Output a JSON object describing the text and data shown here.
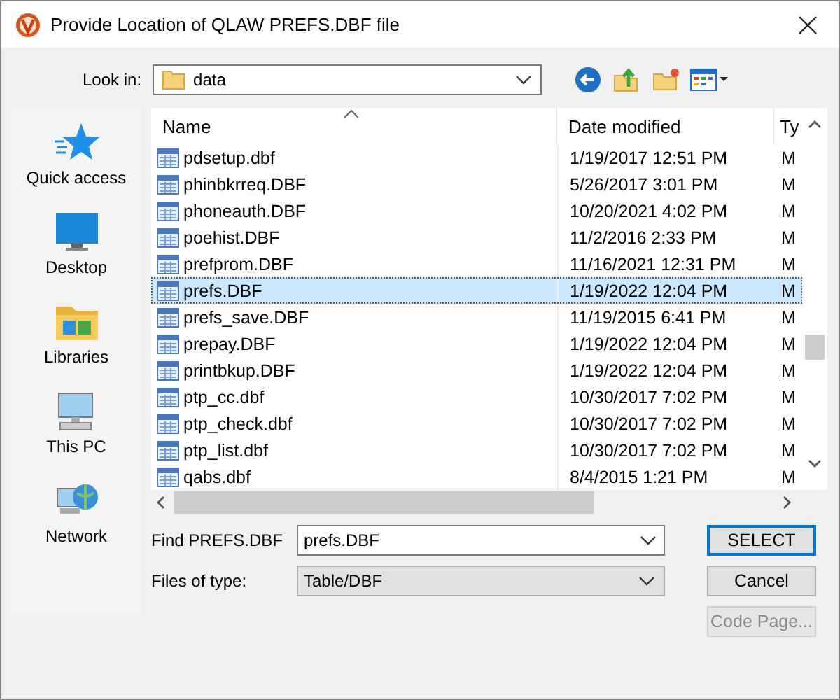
{
  "window": {
    "title": "Provide Location of QLAW PREFS.DBF file"
  },
  "look_in": {
    "label": "Look in:",
    "value": "data"
  },
  "sidebar": {
    "items": [
      {
        "label": "Quick access",
        "kind": "star"
      },
      {
        "label": "Desktop",
        "kind": "desktop"
      },
      {
        "label": "Libraries",
        "kind": "libraries"
      },
      {
        "label": "This PC",
        "kind": "pc"
      },
      {
        "label": "Network",
        "kind": "network"
      }
    ]
  },
  "table": {
    "columns": [
      "Name",
      "Date modified",
      "Ty"
    ],
    "rows": [
      {
        "name": "pdsetup.dbf",
        "date": "1/19/2017 12:51 PM",
        "type": "M",
        "selected": false
      },
      {
        "name": "phinbkrreq.DBF",
        "date": "5/26/2017 3:01 PM",
        "type": "M",
        "selected": false
      },
      {
        "name": "phoneauth.DBF",
        "date": "10/20/2021 4:02 PM",
        "type": "M",
        "selected": false
      },
      {
        "name": "poehist.DBF",
        "date": "11/2/2016 2:33 PM",
        "type": "M",
        "selected": false
      },
      {
        "name": "prefprom.DBF",
        "date": "11/16/2021 12:31 PM",
        "type": "M",
        "selected": false
      },
      {
        "name": "prefs.DBF",
        "date": "1/19/2022 12:04 PM",
        "type": "M",
        "selected": true
      },
      {
        "name": "prefs_save.DBF",
        "date": "11/19/2015 6:41 PM",
        "type": "M",
        "selected": false
      },
      {
        "name": "prepay.DBF",
        "date": "1/19/2022 12:04 PM",
        "type": "M",
        "selected": false
      },
      {
        "name": "printbkup.DBF",
        "date": "1/19/2022 12:04 PM",
        "type": "M",
        "selected": false
      },
      {
        "name": "ptp_cc.dbf",
        "date": "10/30/2017 7:02 PM",
        "type": "M",
        "selected": false
      },
      {
        "name": "ptp_check.dbf",
        "date": "10/30/2017 7:02 PM",
        "type": "M",
        "selected": false
      },
      {
        "name": "ptp_list.dbf",
        "date": "10/30/2017 7:02 PM",
        "type": "M",
        "selected": false
      },
      {
        "name": "qabs.dbf",
        "date": "8/4/2015 1:21 PM",
        "type": "M",
        "selected": false
      }
    ]
  },
  "find": {
    "label": "Find PREFS.DBF",
    "value": "prefs.DBF"
  },
  "file_type": {
    "label": "Files of type:",
    "value": "Table/DBF"
  },
  "buttons": [
    {
      "label": "SELECT",
      "default": true,
      "disabled": false
    },
    {
      "label": "Cancel",
      "default": false,
      "disabled": false
    },
    {
      "label": "Code Page...",
      "default": false,
      "disabled": true
    }
  ]
}
